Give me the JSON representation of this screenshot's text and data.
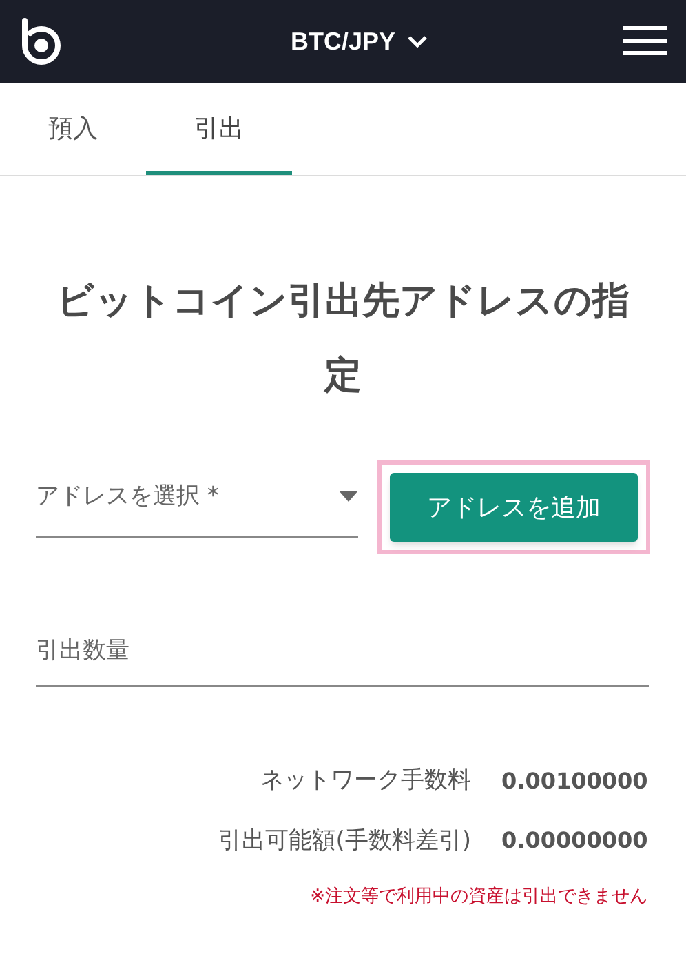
{
  "header": {
    "pair": "BTC/JPY"
  },
  "tabs": [
    {
      "label": "預入",
      "selected": false
    },
    {
      "label": "引出",
      "selected": true
    }
  ],
  "title": "ビットコイン引出先アドレスの指定",
  "address_select": {
    "placeholder": "アドレスを選択 *"
  },
  "add_address_button": {
    "label": "アドレスを追加",
    "highlighted": true
  },
  "amount_field": {
    "placeholder": "引出数量"
  },
  "summary": [
    {
      "label": "ネットワーク手数料",
      "value": "0.00100000"
    },
    {
      "label": "引出可能額(手数料差引)",
      "value": "0.00000000"
    }
  ],
  "note": "※注文等で利用中の資産は引出できません"
}
